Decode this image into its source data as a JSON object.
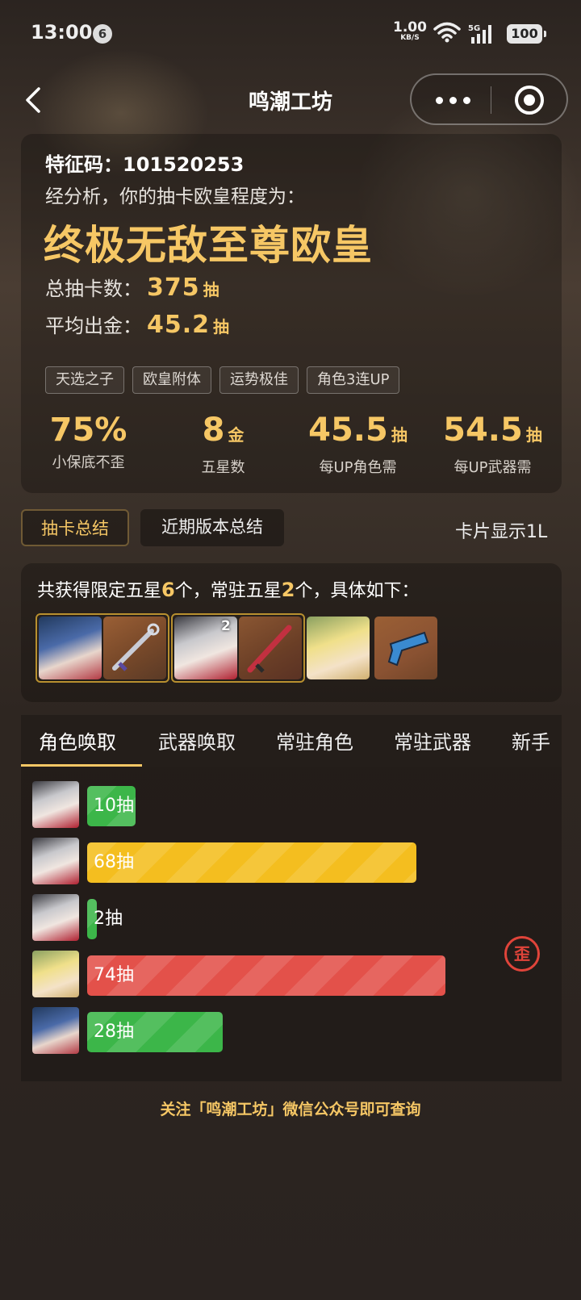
{
  "status_bar": {
    "time": "13:00",
    "notification_count": "6",
    "net_speed": "1.00",
    "net_unit": "KB/S",
    "network": "5G",
    "battery": "100"
  },
  "nav": {
    "title": "鸣潮工坊"
  },
  "summary": {
    "code_label": "特征码：",
    "code_value": "101520253",
    "analysis_text": "经分析，你的抽卡欧皇程度为：",
    "rank_title": "终极无敌至尊欧皇",
    "total_label": "总抽卡数：",
    "total_value": "375",
    "total_unit": "抽",
    "avg_label": "平均出金：",
    "avg_value": "45.2",
    "avg_unit": "抽",
    "tags": [
      "天选之子",
      "欧皇附体",
      "运势极佳",
      "角色3连UP"
    ],
    "metrics": [
      {
        "value": "75%",
        "unit": "",
        "label": "小保底不歪"
      },
      {
        "value": "8",
        "unit": "金",
        "label": "五星数"
      },
      {
        "value": "45.5",
        "unit": "抽",
        "label": "每UP角色需"
      },
      {
        "value": "54.5",
        "unit": "抽",
        "label": "每UP武器需"
      }
    ]
  },
  "tabs_primary": {
    "active": "抽卡总结",
    "second": "近期版本总结",
    "right": "卡片显示1L"
  },
  "obtained": {
    "prefix": "共获得限定五星",
    "limited_count": "6",
    "middle": "个，常驻五星",
    "standard_count": "2",
    "suffix": "个，具体如下：",
    "duplicate_count": "2"
  },
  "tabs_secondary": [
    "角色唤取",
    "武器唤取",
    "常驻角色",
    "常驻武器",
    "新手"
  ],
  "pull_bars": [
    {
      "pulls": 10,
      "label": "10抽",
      "color": "#3cb649",
      "lost": false
    },
    {
      "pulls": 68,
      "label": "68抽",
      "color": "#f4be1f",
      "lost": false
    },
    {
      "pulls": 2,
      "label": "2抽",
      "color": "#3cb649",
      "lost": false
    },
    {
      "pulls": 74,
      "label": "74抽",
      "color": "#e3514a",
      "lost": true
    },
    {
      "pulls": 28,
      "label": "28抽",
      "color": "#3cb649",
      "lost": false
    }
  ],
  "lost_badge": "歪",
  "footer": "关注「鸣潮工坊」微信公众号即可查询",
  "colors": {
    "accent_gold": "#f6c765",
    "bar_green": "#3cb649",
    "bar_yellow": "#f4be1f",
    "bar_red": "#e3514a"
  }
}
